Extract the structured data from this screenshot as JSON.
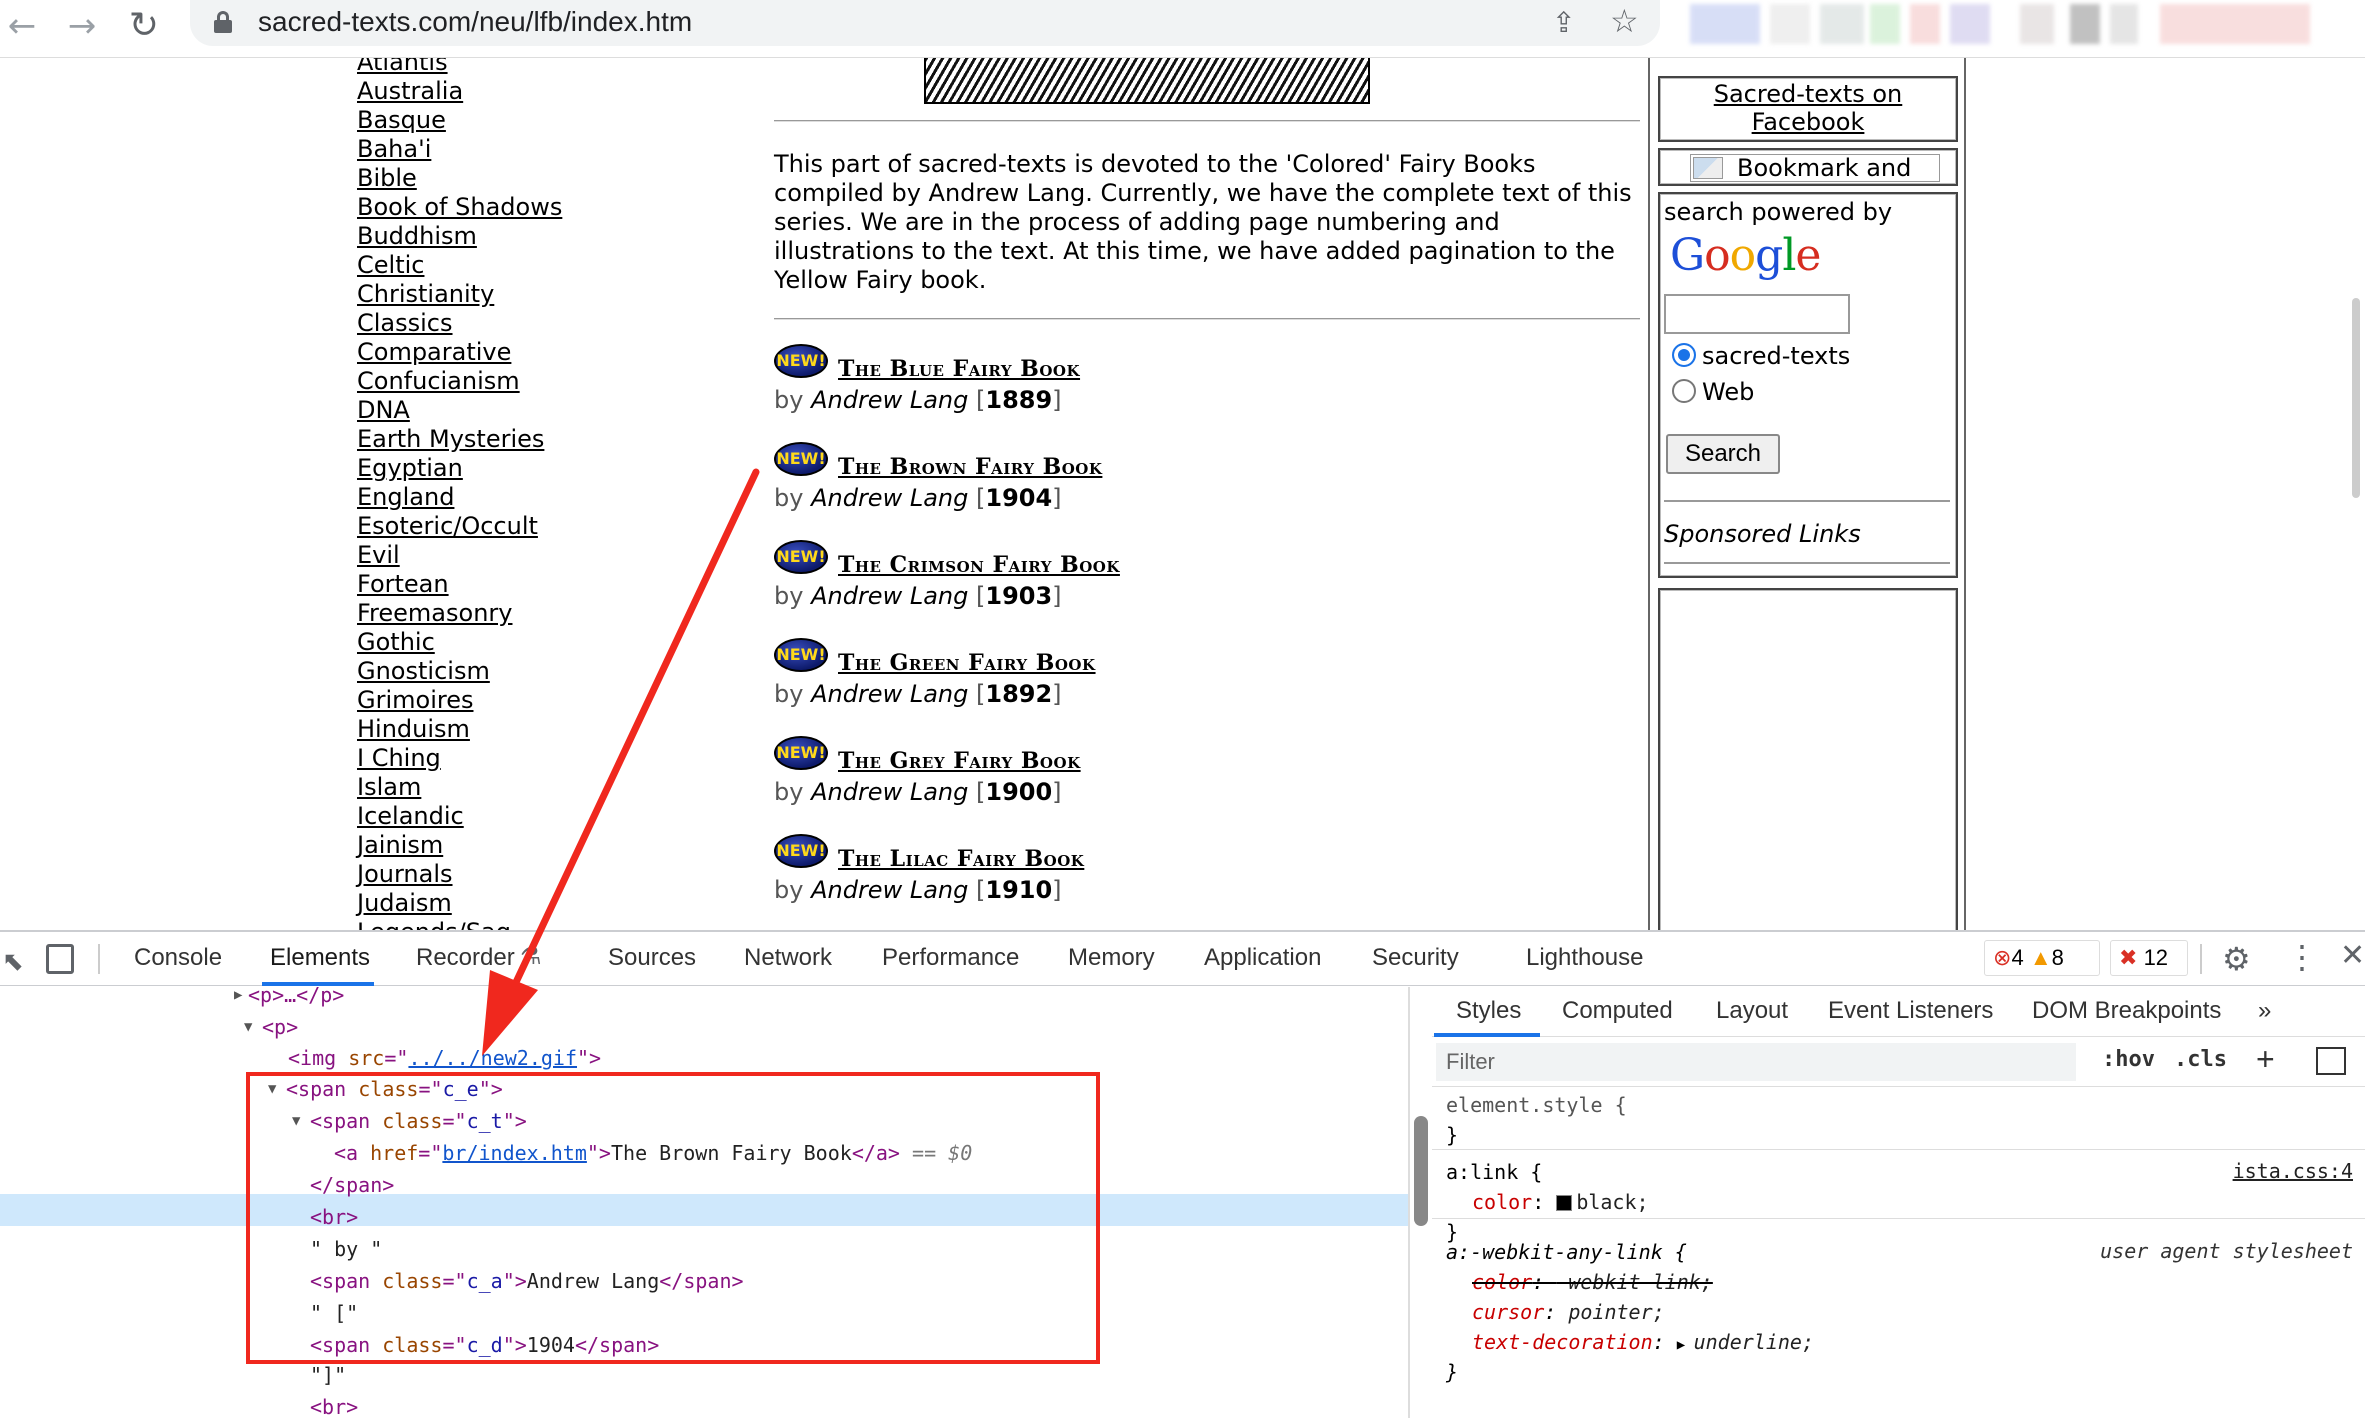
{
  "browser": {
    "url": "sacred-texts.com/neu/lfb/index.htm"
  },
  "categories": [
    "Atlantis",
    "Australia",
    "Basque",
    "Baha'i",
    "Bible",
    "Book of Shadows",
    "Buddhism",
    "Celtic",
    "Christianity",
    "Classics",
    "Comparative",
    "Confucianism",
    "DNA",
    "Earth Mysteries",
    "Egyptian",
    "England",
    "Esoteric/Occult",
    "Evil",
    "Fortean",
    "Freemasonry",
    "Gothic",
    "Gnosticism",
    "Grimoires",
    "Hinduism",
    "I Ching",
    "Islam",
    "Icelandic",
    "Jainism",
    "Journals",
    "Judaism",
    "Legends/Sag"
  ],
  "intro": "This part of sacred-texts is devoted to the 'Colored' Fairy Books compiled by Andrew Lang. Currently, we have the complete text of this series. We are in the process of adding page numbering and illustrations to the text. At this time, we have added pagination to the Yellow Fairy book.",
  "new_badge": "NEW!",
  "books": [
    {
      "title": "The Blue Fairy Book",
      "by": "by",
      "author": "Andrew Lang",
      "open": "[",
      "year": "1889",
      "close": "]"
    },
    {
      "title": "The Brown Fairy Book",
      "by": "by",
      "author": "Andrew Lang",
      "open": "[",
      "year": "1904",
      "close": "]"
    },
    {
      "title": "The Crimson Fairy Book",
      "by": "by",
      "author": "Andrew Lang",
      "open": "[",
      "year": "1903",
      "close": "]"
    },
    {
      "title": "The Green Fairy Book",
      "by": "by",
      "author": "Andrew Lang",
      "open": "[",
      "year": "1892",
      "close": "]"
    },
    {
      "title": "The Grey Fairy Book",
      "by": "by",
      "author": "Andrew Lang",
      "open": "[",
      "year": "1900",
      "close": "]"
    },
    {
      "title": "The Lilac Fairy Book",
      "by": "by",
      "author": "Andrew Lang",
      "open": "[",
      "year": "1910",
      "close": "]"
    }
  ],
  "sidebar": {
    "facebook_line1": "Sacred-texts on",
    "facebook_line2": "Facebook",
    "bookmark": "Bookmark and",
    "powered_by": "search powered by",
    "radio_site": "sacred-texts",
    "radio_web": "Web",
    "search_button": "Search",
    "sponsored": "Sponsored Links"
  },
  "devtools": {
    "tabs": [
      "Console",
      "Elements",
      "Recorder",
      "Sources",
      "Network",
      "Performance",
      "Memory",
      "Application",
      "Security",
      "Lighthouse"
    ],
    "active_tab": "Elements",
    "errors": "4",
    "warnings": "8",
    "issues": "12",
    "code": {
      "p_collapsed": "<p>…</p>",
      "p_open": "<p>",
      "img_src": "../../new2.gif",
      "span_e": "c_e",
      "span_t": "c_t",
      "a_href": "br/index.htm",
      "a_text": "The Brown Fairy Book",
      "eq_dollar": " == $0",
      "by_text": "\" by \"",
      "span_a": "c_a",
      "author": "Andrew Lang",
      "open_text": "\" [\"",
      "span_d": "c_d",
      "year": "1904",
      "close_text": "\"]\"",
      "br": "<br>"
    },
    "styles": {
      "tabs": [
        "Styles",
        "Computed",
        "Layout",
        "Event Listeners",
        "DOM Breakpoints"
      ],
      "active_tab": "Styles",
      "filter_placeholder": "Filter",
      "hov": ":hov",
      "cls": ".cls",
      "rule1_selector": "element.style {",
      "rule_close": "}",
      "rule2_selector": "a:link {",
      "rule2_source": "ista.css:4",
      "rule2_prop": "color",
      "rule2_val": "black;",
      "rule3_selector": "a:-webkit-any-link {",
      "rule3_source": "user agent stylesheet",
      "rule3_prop1": "color",
      "rule3_val1": "-webkit-link;",
      "rule3_prop2": "cursor",
      "rule3_val2": "pointer;",
      "rule3_prop3": "text-decoration",
      "rule3_val3": "underline;"
    }
  },
  "colors": {
    "annotation": "#f0281e",
    "devtools_accent": "#1a73e8",
    "selected_row": "#cfe8fc"
  }
}
